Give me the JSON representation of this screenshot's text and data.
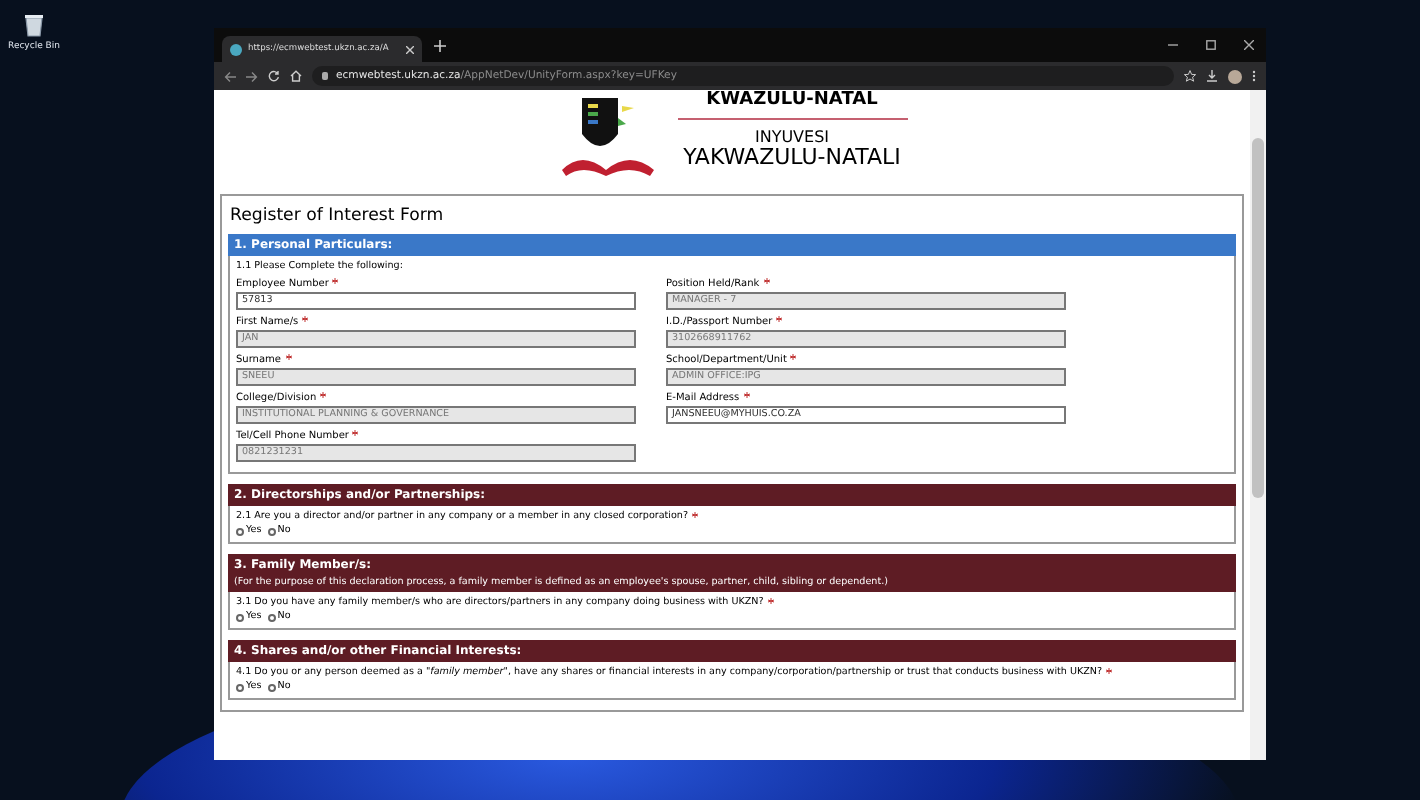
{
  "desktop": {
    "icons": [
      {
        "label": "Recycle Bin"
      }
    ]
  },
  "browser": {
    "tab_title": "https://ecmwebtest.ukzn.ac.za/A",
    "url_host": "ecmwebtest.ukzn.ac.za",
    "url_path": "/AppNetDev/UnityForm.aspx?key=UFKey"
  },
  "logo": {
    "lines": [
      "KWAZULU-NATAL",
      "INYUVESI",
      "YAKWAZULU-NATALI"
    ]
  },
  "form": {
    "title": "Register of Interest Form",
    "sections": [
      {
        "title": "1. Personal Particulars:",
        "color": "#3a78c8",
        "subheading": "1.1 Please Complete the following:",
        "fields": [
          {
            "label": "Employee Number",
            "value": "57813",
            "required": true,
            "disabled": false
          },
          {
            "label": "Position Held/Rank",
            "value": "MANAGER - 7",
            "required": true,
            "disabled": true
          },
          {
            "label": "First Name/s",
            "value": "JAN",
            "required": true,
            "disabled": true
          },
          {
            "label": "I.D./Passport Number",
            "value": "3102668911762",
            "required": true,
            "disabled": true
          },
          {
            "label": "Surname",
            "value": "SNEEU",
            "required": true,
            "disabled": true
          },
          {
            "label": "School/Department/Unit",
            "value": "ADMIN OFFICE:IPG",
            "required": true,
            "disabled": true
          },
          {
            "label": "College/Division",
            "value": "INSTITUTIONAL PLANNING & GOVERNANCE",
            "required": true,
            "disabled": true
          },
          {
            "label": "E-Mail Address",
            "value": "JANSNEEU@MYHUIS.CO.ZA",
            "required": true,
            "disabled": false
          },
          {
            "label": "Tel/Cell Phone Number",
            "value": "0821231231",
            "required": true,
            "disabled": true
          }
        ]
      },
      {
        "title": "2. Directorships and/or Partnerships:",
        "color": "#5e1c24",
        "questions": [
          {
            "text": "2.1 Are you a director and/or partner in any company or a member in any closed corporation?",
            "required": true,
            "options": [
              {
                "label": "Yes",
                "selected": false
              },
              {
                "label": "No",
                "selected": false
              }
            ]
          }
        ]
      },
      {
        "title": "3. Family Member/s:",
        "color": "#5e1c24",
        "note": "(For the purpose of this declaration process, a family member is defined as an employee's spouse, partner, child, sibling or dependent.)",
        "questions": [
          {
            "text": "3.1 Do you have any family member/s who are directors/partners in any company doing business with UKZN?",
            "required": true,
            "options": [
              {
                "label": "Yes",
                "selected": false
              },
              {
                "label": "No",
                "selected": false
              }
            ]
          }
        ]
      },
      {
        "title": "4. Shares and/or other Financial Interests:",
        "color": "#5e1c24",
        "questions": [
          {
            "text": "4.1 Do you or any person deemed as a \"*family member*\", have any shares or financial interests in any company/corporation/partnership or trust that conducts business with UKZN?",
            "required": true,
            "options": [
              {
                "label": "Yes",
                "selected": false
              },
              {
                "label": "No",
                "selected": false
              }
            ]
          }
        ]
      }
    ]
  }
}
